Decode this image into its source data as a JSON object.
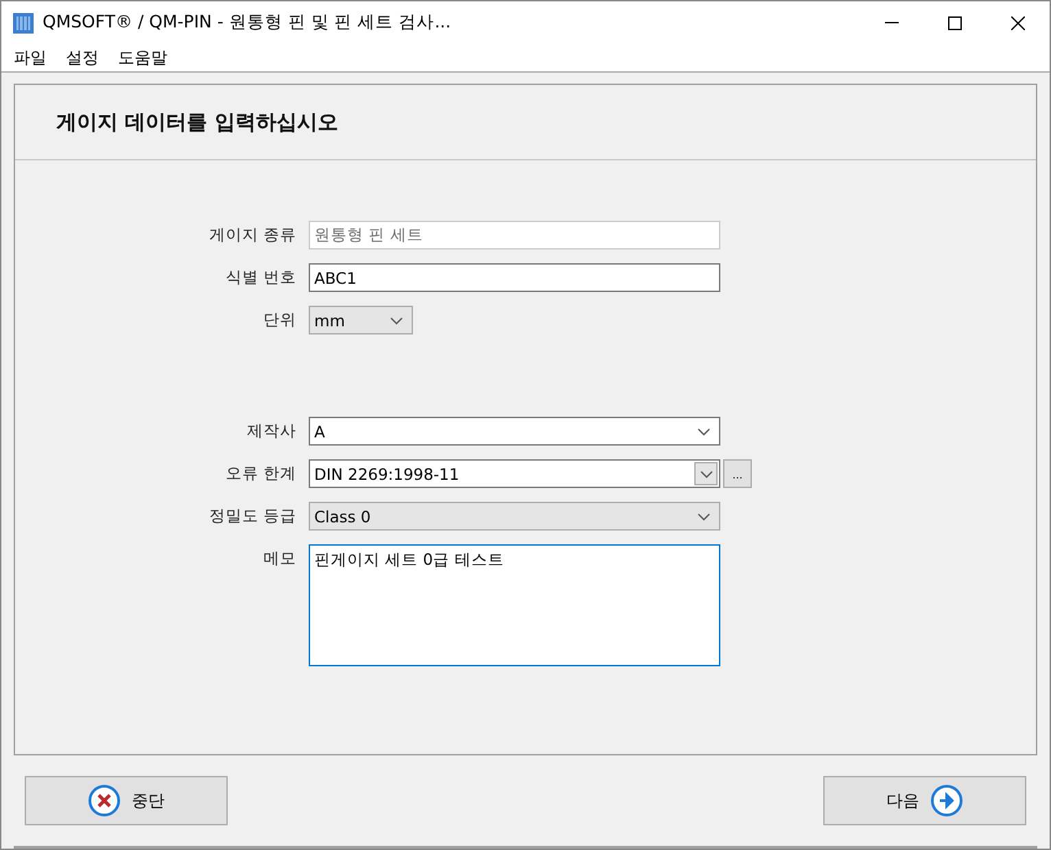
{
  "window": {
    "title": "QMSOFT® / QM-PIN - 원통형 핀 및 핀 세트 검사..."
  },
  "menu": [
    "파일",
    "설정",
    "도움말"
  ],
  "heading": "게이지 데이터를 입력하십시오",
  "groups": [
    [
      {
        "label": "게이지 종류",
        "kind": "text",
        "value": "원통형 핀 세트",
        "disabled": true
      },
      {
        "label": "식별 번호",
        "kind": "text",
        "value": "ABC1",
        "disabled": false
      },
      {
        "label": "단위",
        "kind": "small-dropdown",
        "value": "mm"
      }
    ],
    [
      {
        "label": "제작사",
        "kind": "combo",
        "value": "A"
      }
    ],
    [
      {
        "label": "오류 한계",
        "kind": "combo",
        "value": "DIN 2269:1998-11",
        "button": "..."
      },
      {
        "label": "정밀도 등급",
        "kind": "dropdown",
        "value": "Class 0"
      }
    ],
    [
      {
        "label": "메모",
        "kind": "memo",
        "value": "핀게이지 세트 0급 테스트"
      }
    ]
  ],
  "buttons": [
    {
      "label": "중단",
      "kind": "cancel"
    },
    {
      "label": "다음",
      "kind": "next"
    }
  ]
}
